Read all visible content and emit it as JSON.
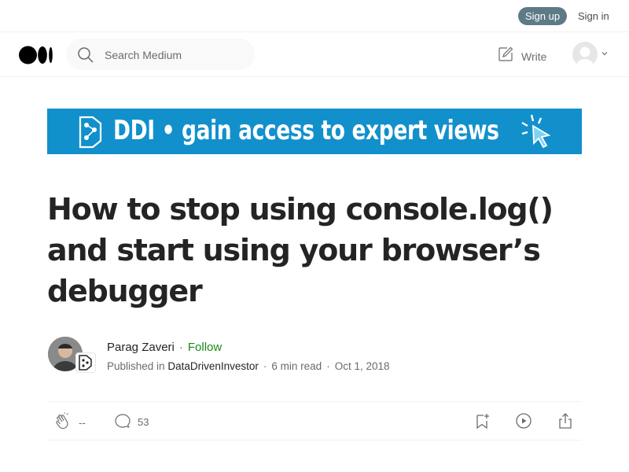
{
  "topbar": {
    "signup_label": "Sign up",
    "signin_label": "Sign in"
  },
  "header": {
    "logo_icon": "medium-logo-icon",
    "search_placeholder": "Search Medium",
    "write_label": "Write",
    "avatar_icon": "user-avatar-icon"
  },
  "banner": {
    "text": "DDI • gain access to expert views",
    "bg_color": "#1290cc"
  },
  "article": {
    "title": "How to stop using console.log() and start using your browser’s debugger",
    "author": {
      "name": "Parag Zaveri",
      "separator": "·",
      "follow_label": "Follow",
      "published_in_prefix": "Published in",
      "publication": "DataDrivenInvestor",
      "read_time": "6 min read",
      "date": "Oct 1, 2018"
    },
    "actions": {
      "claps": "--",
      "responses": "53"
    }
  },
  "colors": {
    "follow": "#1a8917",
    "signup_bg": "#5e7a86"
  }
}
